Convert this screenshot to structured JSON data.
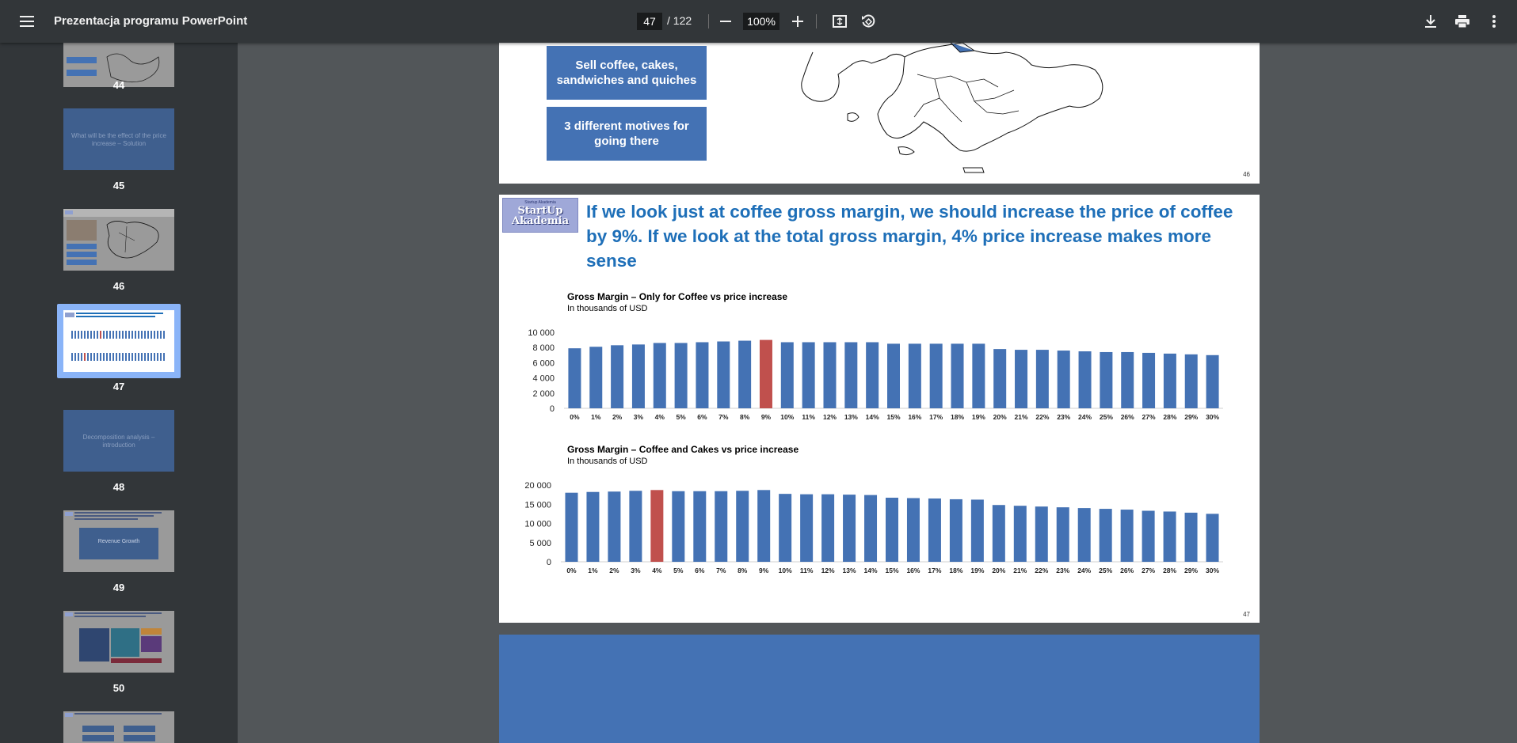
{
  "toolbar": {
    "title": "Prezentacja programu PowerPoint",
    "page_current": "47",
    "page_total": "/ 122",
    "zoom": "100%"
  },
  "sidebar": {
    "thumbnails": [
      {
        "page": "44"
      },
      {
        "page": "45",
        "text": "What will be the effect of the price increase – Solution"
      },
      {
        "page": "46"
      },
      {
        "page": "47"
      },
      {
        "page": "48",
        "text": "Decomposition analysis – introduction"
      },
      {
        "page": "49",
        "text": "Revenue Growth"
      },
      {
        "page": "50"
      }
    ]
  },
  "slide46": {
    "box1": "Sell coffee, cakes, sandwiches and quiches",
    "box2": "3 different motives for going there",
    "page_number": "46"
  },
  "slide47": {
    "logo_top": "Startup Akademia",
    "logo_main1": "StartUp",
    "logo_main2": "Akademia",
    "title": "If we look just at coffee gross margin, we should increase the price of coffee by 9%. If we look at the total gross margin, 4%  price increase makes more sense",
    "page_number": "47"
  },
  "chart_data": [
    {
      "type": "bar",
      "title": "Gross Margin – Only for Coffee vs price increase",
      "subtitle": "In thousands of USD",
      "categories": [
        "0%",
        "1%",
        "2%",
        "3%",
        "4%",
        "5%",
        "6%",
        "7%",
        "8%",
        "9%",
        "10%",
        "11%",
        "12%",
        "13%",
        "14%",
        "15%",
        "16%",
        "17%",
        "18%",
        "19%",
        "20%",
        "21%",
        "22%",
        "23%",
        "24%",
        "25%",
        "26%",
        "27%",
        "28%",
        "29%",
        "30%"
      ],
      "values": [
        7900,
        8100,
        8300,
        8400,
        8600,
        8600,
        8700,
        8800,
        8900,
        9000,
        8700,
        8700,
        8700,
        8700,
        8700,
        8500,
        8500,
        8500,
        8500,
        8500,
        7800,
        7700,
        7700,
        7600,
        7500,
        7400,
        7400,
        7300,
        7200,
        7100,
        7000
      ],
      "highlight_index": 9,
      "yticks": [
        "0",
        "2 000",
        "4 000",
        "6 000",
        "8 000",
        "10 000"
      ],
      "ylim": [
        0,
        10000
      ],
      "bar_color": "#4472b4",
      "highlight_color": "#c0504d"
    },
    {
      "type": "bar",
      "title": "Gross Margin – Coffee and Cakes vs price increase",
      "subtitle": "In thousands of USD",
      "categories": [
        "0%",
        "1%",
        "2%",
        "3%",
        "4%",
        "5%",
        "6%",
        "7%",
        "8%",
        "9%",
        "10%",
        "11%",
        "12%",
        "13%",
        "14%",
        "15%",
        "16%",
        "17%",
        "18%",
        "19%",
        "20%",
        "21%",
        "22%",
        "23%",
        "24%",
        "25%",
        "26%",
        "27%",
        "28%",
        "29%",
        "30%"
      ],
      "values": [
        18000,
        18200,
        18300,
        18500,
        18700,
        18400,
        18400,
        18400,
        18500,
        18700,
        17700,
        17600,
        17600,
        17500,
        17400,
        16700,
        16600,
        16500,
        16300,
        16200,
        14800,
        14600,
        14400,
        14200,
        14000,
        13800,
        13600,
        13300,
        13100,
        12800,
        12500
      ],
      "highlight_index": 4,
      "yticks": [
        "0",
        "5 000",
        "10 000",
        "15 000",
        "20 000"
      ],
      "ylim": [
        0,
        20000
      ],
      "bar_color": "#4472b4",
      "highlight_color": "#c0504d"
    }
  ]
}
